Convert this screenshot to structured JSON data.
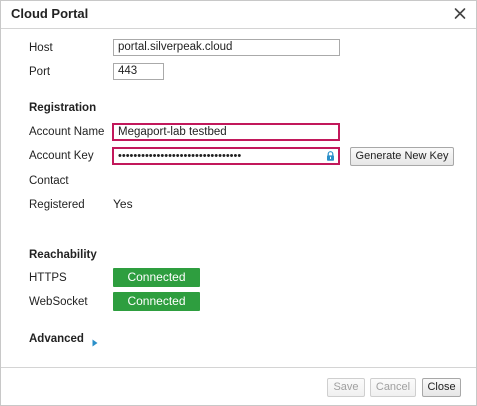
{
  "dialog": {
    "title": "Cloud Portal",
    "close_icon": "close-icon"
  },
  "connection": {
    "host_label": "Host",
    "host_value": "portal.silverpeak.cloud",
    "port_label": "Port",
    "port_value": "443"
  },
  "registration": {
    "heading": "Registration",
    "account_name_label": "Account Name",
    "account_name_value": "Megaport-lab testbed",
    "account_key_label": "Account Key",
    "account_key_value": "••••••••••••••••••••••••••••••••",
    "lock_icon": "lock-icon",
    "generate_key_label": "Generate New Key",
    "contact_label": "Contact",
    "registered_label": "Registered",
    "registered_value": "Yes"
  },
  "reachability": {
    "heading": "Reachability",
    "https_label": "HTTPS",
    "https_status": "Connected",
    "websocket_label": "WebSocket",
    "websocket_status": "Connected",
    "status_color": "#2e9e3f"
  },
  "advanced": {
    "label": "Advanced",
    "arrow_icon": "caret-right-icon"
  },
  "footer": {
    "save_label": "Save",
    "cancel_label": "Cancel",
    "close_label": "Close"
  },
  "colors": {
    "highlight_border": "#c2185b",
    "connected_green": "#2e9e3f",
    "arrow_blue": "#2a8fc9"
  }
}
